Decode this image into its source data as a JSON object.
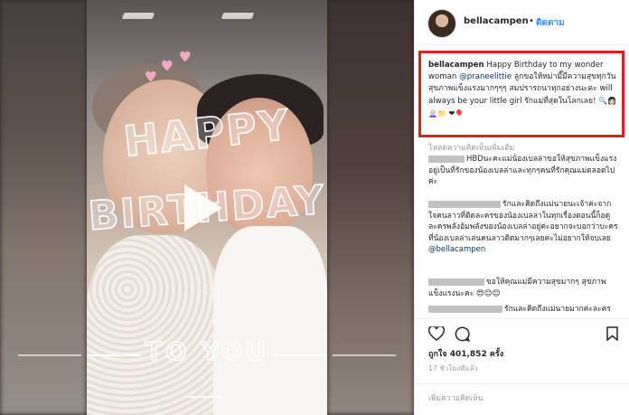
{
  "post": {
    "username": "bellacampen",
    "dot": "•",
    "follow_label": "ติดตาม"
  },
  "media": {
    "overlay_title_1": "HAPPY",
    "overlay_title_2": "BIRTHDAY",
    "overlay_footer": "TO YOU",
    "hearts": [
      "♥",
      "♥",
      "♥"
    ],
    "play_icon": "play-icon"
  },
  "caption": {
    "username": "bellacampen",
    "text_1": "Happy Birthday to my wonder woman",
    "mention": "@praneelittie",
    "text_2": "ลูกขอให้หม่ามี๊มีความสุขทุกวัน สุขภาพแข็งแรงมากๆๆๆ สมปรารถนาทุกอย่างนะคะ will always be your little girl รักแม่ที่สุดในโลกเลย!",
    "emojis": "🔍👩🏻👩🏻‍🦳📁 ❤🎈"
  },
  "comments": {
    "load_more": "โหลดความคิดเห็นเพิ่มเติม",
    "items": [
      {
        "text": "HBDนะคะแม่น้องเบลล่าขอให้สุขภาพแข็งแรงอยู่เป็นที่รักของน้องเบลล่าและทุกๆคนที่รักคุณแม่ตลอดไปค่ะ"
      },
      {
        "text": "รักและคิดถึงแม่นายนะเจ้าค่ะจากใจคนลาวที่ติดละครของน้องเบลล่าในทุกเรื่องตอนนี้ก็อดูละครพลังอ้มพลังของน้องเบลล่าอยู่ค่ะอยากจะบอกว่าบะครที่น้องเบลล่าเล่นคนลาวติดมากๆเลยค่ะไม่อยากให้จบเลย",
        "mention": "@bellacampen"
      },
      {
        "text": "ขอให้คุณแม่มีความสุขมากๆ สุขภาพแข็งแรงนะคะ",
        "emojis": "😍😊😊"
      },
      {
        "text": "รักและคิดถึงแม่นายมากค่ะละคร"
      }
    ]
  },
  "actions": {
    "like_icon": "heart-icon",
    "comment_icon": "comment-icon",
    "save_icon": "bookmark-icon",
    "likes_label": "ถูกใจ",
    "likes_count": "401,852",
    "likes_unit": "ครั้ง",
    "time": "17 ชั่วโมงที่แล้ว"
  },
  "add_comment": {
    "placeholder": "เพิ่มความคิดเห็น"
  },
  "colors": {
    "highlight_box": "#e11d1d",
    "link": "#3897f0",
    "mention": "#003569",
    "muted": "#999999"
  }
}
